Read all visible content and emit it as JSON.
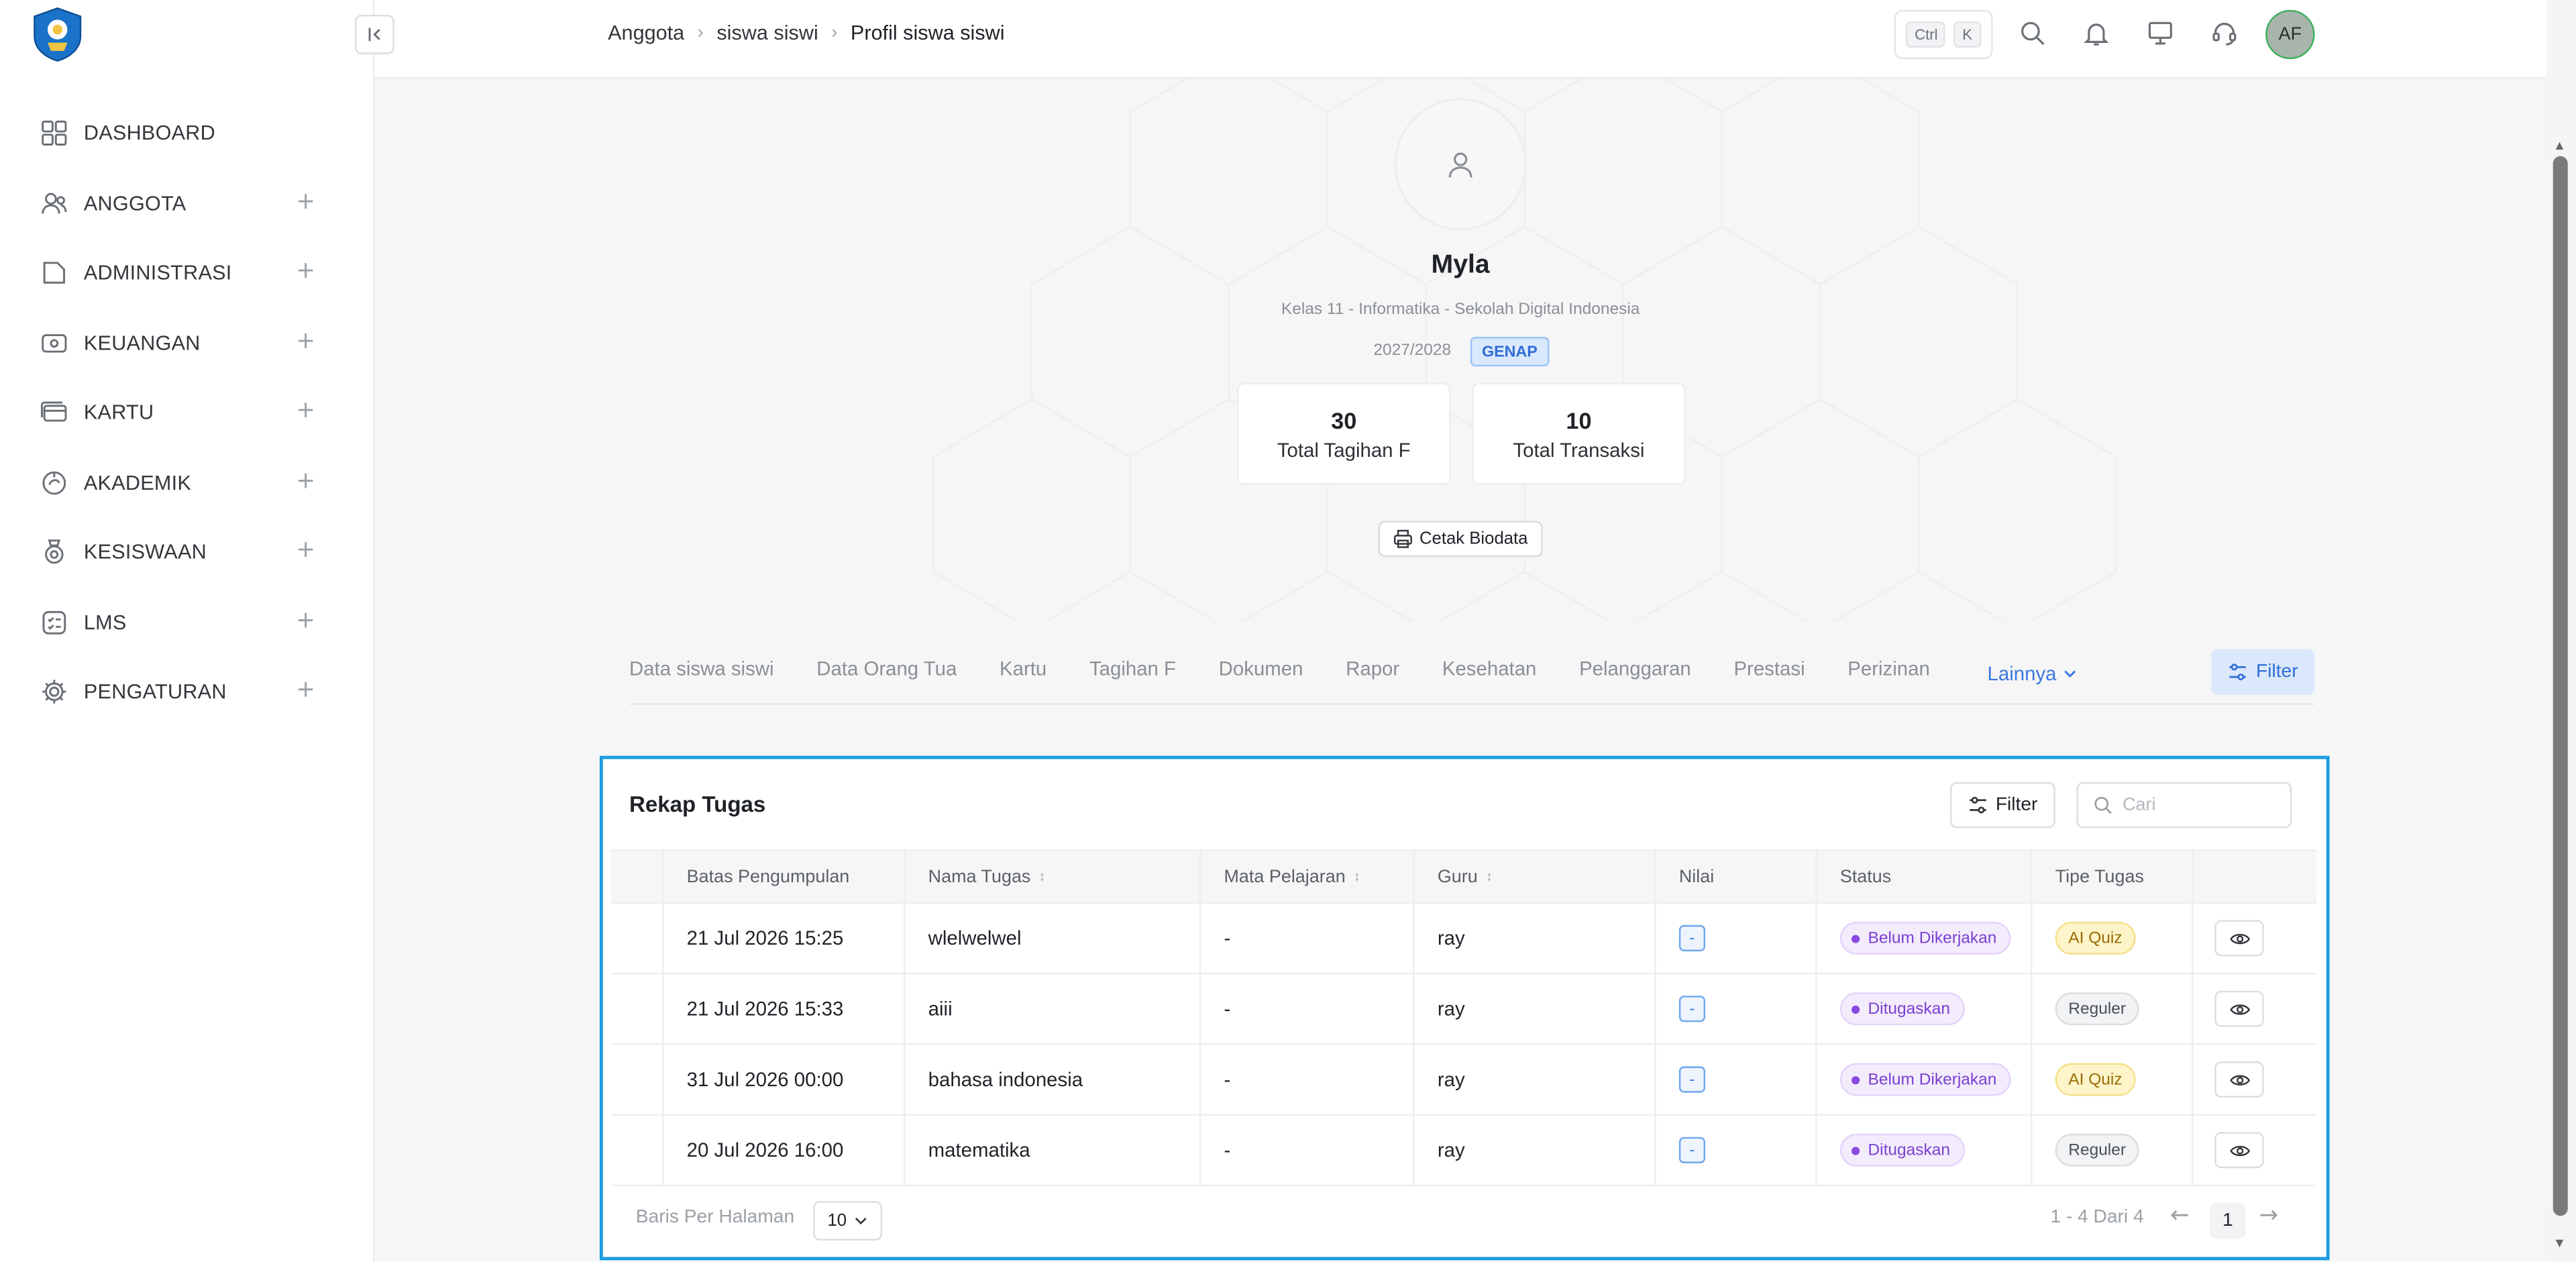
{
  "sidebar": {
    "items": [
      {
        "label": "DASHBOARD",
        "icon": "dashboard-grid-icon",
        "expandable": false
      },
      {
        "label": "ANGGOTA",
        "icon": "users-icon",
        "expandable": true
      },
      {
        "label": "ADMINISTRASI",
        "icon": "folder-icon",
        "expandable": true
      },
      {
        "label": "KEUANGAN",
        "icon": "money-icon",
        "expandable": true
      },
      {
        "label": "KARTU",
        "icon": "card-icon",
        "expandable": true
      },
      {
        "label": "AKADEMIK",
        "icon": "academic-icon",
        "expandable": true
      },
      {
        "label": "KESISWAAN",
        "icon": "medal-icon",
        "expandable": true
      },
      {
        "label": "LMS",
        "icon": "checklist-icon",
        "expandable": true
      },
      {
        "label": "PENGATURAN",
        "icon": "gear-icon",
        "expandable": true
      }
    ]
  },
  "topbar": {
    "breadcrumb": [
      "Anggota",
      "siswa siswi",
      "Profil siswa siswi"
    ],
    "shortcut_keys": [
      "Ctrl",
      "K"
    ],
    "avatar_initials": "AF"
  },
  "profile": {
    "name": "Myla",
    "class_info": "Kelas 11 - Informatika - Sekolah Digital Indonesia",
    "year": "2027/2028",
    "semester_badge": "GENAP",
    "stats": [
      {
        "value": "30",
        "label": "Total Tagihan F"
      },
      {
        "value": "10",
        "label": "Total Transaksi"
      }
    ],
    "print_label": "Cetak Biodata"
  },
  "tabs": {
    "items": [
      "Data siswa siswi",
      "Data Orang Tua",
      "Kartu",
      "Tagihan F",
      "Dokumen",
      "Rapor",
      "Kesehatan",
      "Pelanggaran",
      "Prestasi",
      "Perizinan"
    ],
    "more_label": "Lainnya",
    "filter_label": "Filter"
  },
  "table": {
    "title": "Rekap Tugas",
    "filter_label": "Filter",
    "search_placeholder": "Cari",
    "columns": [
      "Batas Pengumpulan",
      "Nama Tugas",
      "Mata Pelajaran",
      "Guru",
      "Nilai",
      "Status",
      "Tipe Tugas"
    ],
    "rows": [
      {
        "deadline": "21 Jul 2026 15:25",
        "name": "wlelwelwel",
        "subject": "-",
        "teacher": "ray",
        "score": "-",
        "status": "Belum Dikerjakan",
        "type": "AI Quiz"
      },
      {
        "deadline": "21 Jul 2026 15:33",
        "name": "aiii",
        "subject": "-",
        "teacher": "ray",
        "score": "-",
        "status": "Ditugaskan",
        "type": "Reguler"
      },
      {
        "deadline": "31 Jul 2026 00:00",
        "name": "bahasa indonesia",
        "subject": "-",
        "teacher": "ray",
        "score": "-",
        "status": "Belum Dikerjakan",
        "type": "AI Quiz"
      },
      {
        "deadline": "20 Jul 2026 16:00",
        "name": "matematika",
        "subject": "-",
        "teacher": "ray",
        "score": "-",
        "status": "Ditugaskan",
        "type": "Reguler"
      }
    ],
    "rows_per_page_label": "Baris Per Halaman",
    "rows_per_page_value": "10",
    "range_text": "1 - 4 Dari 4",
    "current_page": "1"
  },
  "colors": {
    "accent": "#3a78e0",
    "panel_border": "#1d9de0",
    "status_purple": "#7a3fd0",
    "ai_quiz_yellow": "#fdf4c9",
    "avatar_ring": "#3db05a"
  }
}
